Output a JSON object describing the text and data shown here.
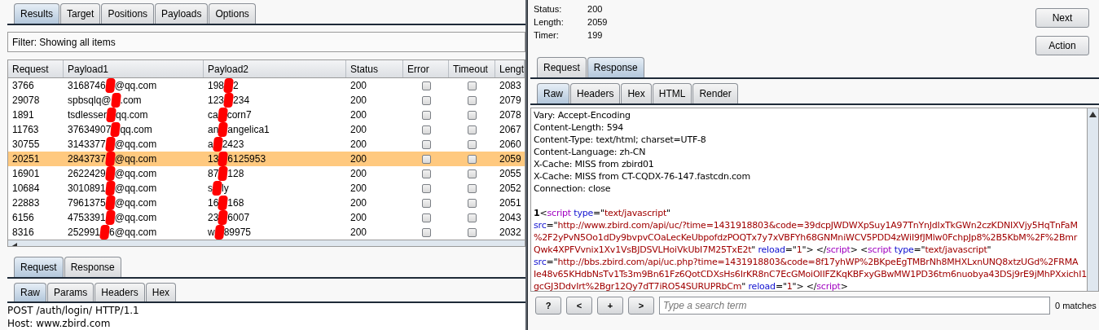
{
  "left_tabs": [
    {
      "label": "Results",
      "selected": true
    },
    {
      "label": "Target",
      "selected": false
    },
    {
      "label": "Positions",
      "selected": false
    },
    {
      "label": "Payloads",
      "selected": false
    },
    {
      "label": "Options",
      "selected": false
    }
  ],
  "filter": "Filter:  Showing all items",
  "table": {
    "columns": [
      "Request",
      "Payload1",
      "Payload2",
      "Status",
      "Error",
      "Timeout",
      "Lengt"
    ],
    "rows": [
      {
        "request": "3766",
        "payload1": [
          "3168746",
          "@qq.com"
        ],
        "payload2": [
          "198",
          "2"
        ],
        "status": "200",
        "error": false,
        "timeout": false,
        "length": "2083",
        "selected": false
      },
      {
        "request": "29078",
        "payload1": [
          "spbsqlq@",
          ".com"
        ],
        "payload2": [
          "123",
          "234"
        ],
        "status": "200",
        "error": false,
        "timeout": false,
        "length": "2079",
        "selected": false
      },
      {
        "request": "1891",
        "payload1": [
          "tsdlesser",
          "qq.com"
        ],
        "payload2": [
          "ca",
          "corn7"
        ],
        "status": "200",
        "error": false,
        "timeout": false,
        "length": "2078",
        "selected": false
      },
      {
        "request": "11763",
        "payload1": [
          "37634907",
          "qq.com"
        ],
        "payload2": [
          "an",
          "angelica1"
        ],
        "status": "200",
        "error": false,
        "timeout": false,
        "length": "2067",
        "selected": false
      },
      {
        "request": "30755",
        "payload1": [
          "3143377",
          "@qq.com"
        ],
        "payload2": [
          "a",
          "2423"
        ],
        "status": "200",
        "error": false,
        "timeout": false,
        "length": "2060",
        "selected": false
      },
      {
        "request": "20251",
        "payload1": [
          "2843737",
          "@qq.com"
        ],
        "payload2": [
          "13",
          "6125953"
        ],
        "status": "200",
        "error": false,
        "timeout": false,
        "length": "2059",
        "selected": true
      },
      {
        "request": "16901",
        "payload1": [
          "2622429",
          "@qq.com"
        ],
        "payload2": [
          "87",
          "128"
        ],
        "status": "200",
        "error": false,
        "timeout": false,
        "length": "2055",
        "selected": false
      },
      {
        "request": "10684",
        "payload1": [
          "3010891",
          "@qq.com"
        ],
        "payload2": [
          "s",
          "ly"
        ],
        "status": "200",
        "error": false,
        "timeout": false,
        "length": "2052",
        "selected": false
      },
      {
        "request": "22883",
        "payload1": [
          "7961375",
          "@qq.com"
        ],
        "payload2": [
          "16",
          "168"
        ],
        "status": "200",
        "error": false,
        "timeout": false,
        "length": "2051",
        "selected": false
      },
      {
        "request": "6156",
        "payload1": [
          "4753391",
          "@qq.com"
        ],
        "payload2": [
          "23",
          "6007"
        ],
        "status": "200",
        "error": false,
        "timeout": false,
        "length": "2043",
        "selected": false
      },
      {
        "request": "8316",
        "payload1": [
          "252991",
          "6@qq.com"
        ],
        "payload2": [
          "w",
          "89975"
        ],
        "status": "200",
        "error": false,
        "timeout": false,
        "length": "2032",
        "selected": false
      }
    ]
  },
  "request_tabs": [
    {
      "label": "Request",
      "selected": true
    },
    {
      "label": "Response",
      "selected": false
    }
  ],
  "request_subtabs": [
    {
      "label": "Raw",
      "selected": true
    },
    {
      "label": "Params",
      "selected": false
    },
    {
      "label": "Headers",
      "selected": false
    },
    {
      "label": "Hex",
      "selected": false
    }
  ],
  "request_lines": [
    "POST /auth/login/ HTTP/1.1",
    "Host: www.zbird.com"
  ],
  "details": [
    {
      "label": "Status:",
      "value": "200"
    },
    {
      "label": "Length:",
      "value": "2059"
    },
    {
      "label": "Timer:",
      "value": "199"
    }
  ],
  "buttons": [
    "Next",
    "Action"
  ],
  "response_tabs": [
    {
      "label": "Request",
      "selected": false
    },
    {
      "label": "Response",
      "selected": true
    }
  ],
  "response_subtabs": [
    {
      "label": "Raw",
      "selected": true
    },
    {
      "label": "Headers",
      "selected": false
    },
    {
      "label": "Hex",
      "selected": false
    },
    {
      "label": "HTML",
      "selected": false
    },
    {
      "label": "Render",
      "selected": false
    }
  ],
  "response_headers": [
    "Vary: Accept-Encoding",
    "Content-Length: 594",
    "Content-Type: text/html; charset=UTF-8",
    "Content-Language: zh-CN",
    "X-Cache: MISS from zbird01",
    "X-Cache: MISS from CT-CQDX-76-147.fastcdn.com",
    "Connection: close"
  ],
  "response_body": [
    [
      {
        "kind": "num",
        "text": "1"
      },
      {
        "kind": "plain",
        "text": "<"
      },
      {
        "kind": "tag",
        "text": "script"
      },
      {
        "kind": "attr",
        "text": " type"
      },
      {
        "kind": "plain",
        "text": "=\""
      },
      {
        "kind": "value",
        "text": "text/javascript"
      },
      {
        "kind": "plain",
        "text": "\""
      }
    ],
    [
      {
        "kind": "attr",
        "text": "src"
      },
      {
        "kind": "plain",
        "text": "=\""
      },
      {
        "kind": "value",
        "text": "http://www.zbird.com/api/uc/?time=1431918803&code=39dcpJWDWXpSuy1A97TnYnJdIxTkGWn2czKDNIXVjy5HqTnFaM"
      }
    ],
    [
      {
        "kind": "value",
        "text": "%2F2yPvN5Oo1dDy9bvpvCOaLecKeUbpofdzPOQTx7y7xVBFYh68GNMniWCV5PDD4zWiI9fJMlw0FchpJp8%2B5KbM%2F%2Bmr"
      }
    ],
    [
      {
        "kind": "value",
        "text": "Qwk4XPFVvnix1Xv1VsBJDSVLHoiVkUbI7M25TxE2t"
      },
      {
        "kind": "plain",
        "text": "\" "
      },
      {
        "kind": "attr",
        "text": "reload"
      },
      {
        "kind": "plain",
        "text": "=\""
      },
      {
        "kind": "value",
        "text": "1"
      },
      {
        "kind": "plain",
        "text": "\"> </"
      },
      {
        "kind": "tag",
        "text": "script"
      },
      {
        "kind": "plain",
        "text": "> <"
      },
      {
        "kind": "tag",
        "text": "script"
      },
      {
        "kind": "attr",
        "text": " type"
      },
      {
        "kind": "plain",
        "text": "=\""
      },
      {
        "kind": "value",
        "text": "text/javascript"
      },
      {
        "kind": "plain",
        "text": "\""
      }
    ],
    [
      {
        "kind": "attr",
        "text": "src"
      },
      {
        "kind": "plain",
        "text": "=\""
      },
      {
        "kind": "value",
        "text": "http://bbs.zbird.com/api/uc.php?time=1431918803&code=8f17yhWP%2BKpeEgTMBrNh8MHXLxnUNQ8xtzUGd%2FRMA"
      }
    ],
    [
      {
        "kind": "value",
        "text": "Ie48v65KHdbNsTv1Ts3m9Bn61Fz6QotCDXsHs6IrKR8nC7EcGMoiOIIFZKqKBFxyGBwMW1PD36tm6nuobya43DSj9rE9jMhPXxichI1"
      }
    ],
    [
      {
        "kind": "value",
        "text": "gcGJ3DdvIrt%2Bgr12Qy7dT7iRO54SURUPRbCm"
      },
      {
        "kind": "plain",
        "text": "\" "
      },
      {
        "kind": "attr",
        "text": "reload"
      },
      {
        "kind": "plain",
        "text": "=\""
      },
      {
        "kind": "value",
        "text": "1"
      },
      {
        "kind": "plain",
        "text": "\"> </"
      },
      {
        "kind": "tag",
        "text": "script"
      },
      {
        "kind": "plain",
        "text": ">"
      }
    ]
  ],
  "search": {
    "buttons": [
      "?",
      "<",
      "+",
      ">"
    ],
    "placeholder": "Type a search term",
    "matches": "0 matches"
  }
}
